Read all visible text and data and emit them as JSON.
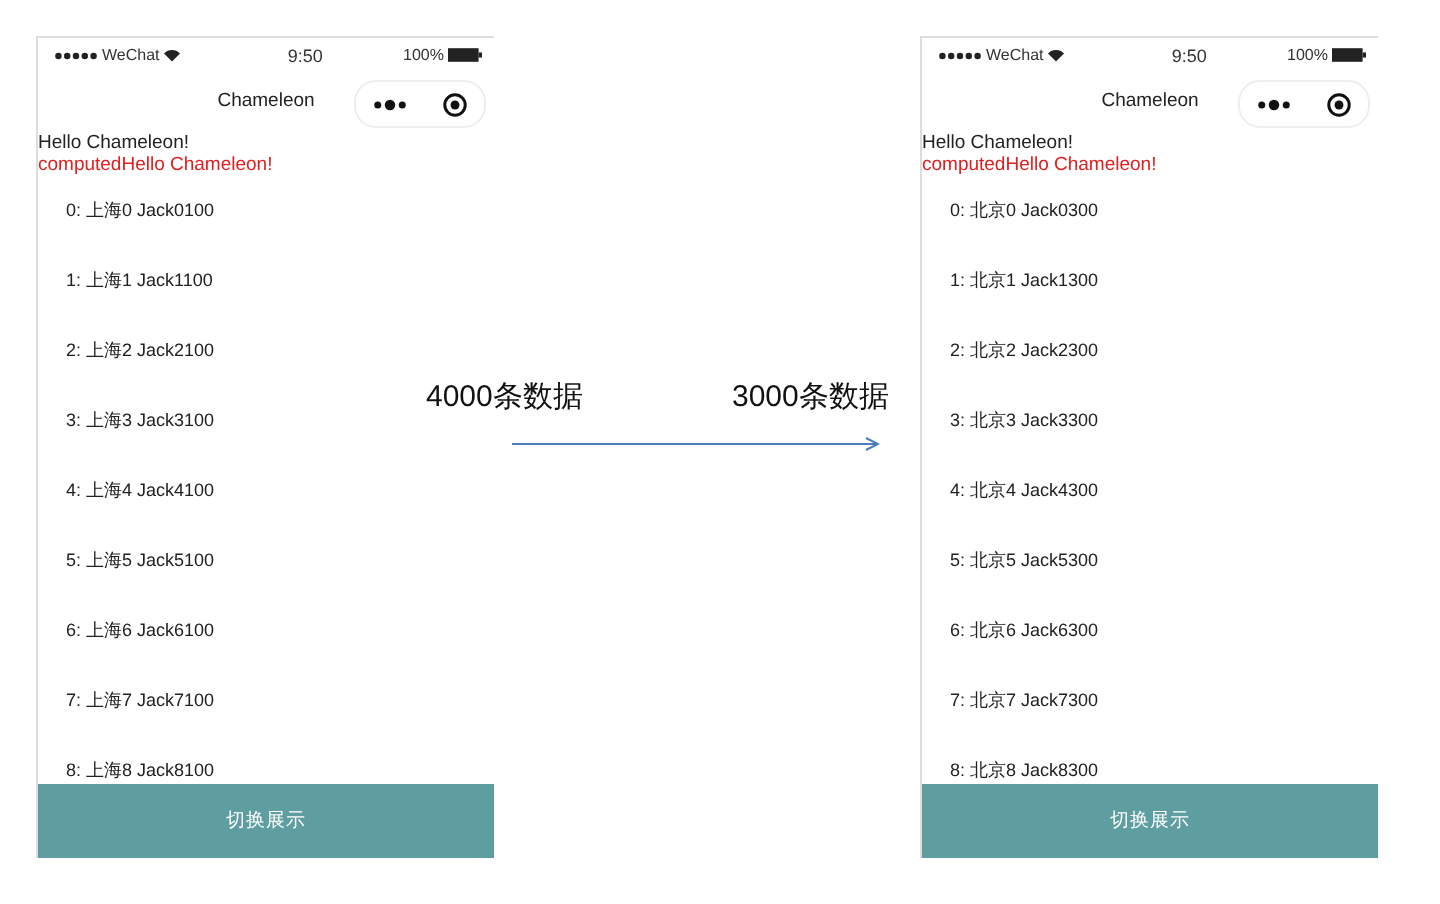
{
  "phones": [
    {
      "status_bar": {
        "carrier": "WeChat",
        "time": "9:50",
        "battery": "100%"
      },
      "nav_title": "Chameleon",
      "greeting": "Hello Chameleon!",
      "computed": "computedHello Chameleon!",
      "rows": [
        "0: 上海0 Jack0100",
        "1: 上海1 Jack1100",
        "2: 上海2 Jack2100",
        "3: 上海3 Jack3100",
        "4: 上海4 Jack4100",
        "5: 上海5 Jack5100",
        "6: 上海6 Jack6100",
        "7: 上海7 Jack7100",
        "8: 上海8 Jack8100"
      ],
      "button": "切换展示"
    },
    {
      "status_bar": {
        "carrier": "WeChat",
        "time": "9:50",
        "battery": "100%"
      },
      "nav_title": "Chameleon",
      "greeting": "Hello Chameleon!",
      "computed": "computedHello Chameleon!",
      "rows": [
        "0: 北京0 Jack0300",
        "1: 北京1 Jack1300",
        "2: 北京2 Jack2300",
        "3: 北京3 Jack3300",
        "4: 北京4 Jack4300",
        "5: 北京5 Jack5300",
        "6: 北京6 Jack6300",
        "7: 北京7 Jack7300",
        "8: 北京8 Jack8300"
      ],
      "button": "切换展示"
    }
  ],
  "annotations": [
    "4000条数据",
    "3000条数据"
  ]
}
